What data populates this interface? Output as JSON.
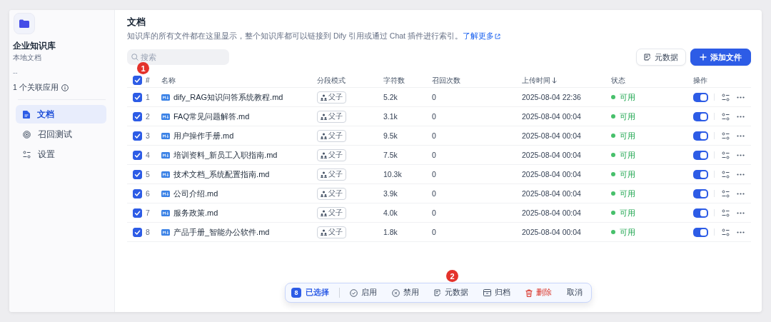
{
  "sidebar": {
    "title": "企业知识库",
    "subtitle": "本地文档",
    "description": "--",
    "linked_apps": "1 个关联应用",
    "nav": [
      {
        "label": "文档",
        "kind": "doc",
        "selected": true
      },
      {
        "label": "召回测试",
        "kind": "target",
        "selected": false
      },
      {
        "label": "设置",
        "kind": "settings",
        "selected": false
      }
    ]
  },
  "header": {
    "title": "文档",
    "description": "知识库的所有文件都在这里显示，整个知识库都可以链接到 Dify 引用或通过 Chat 插件进行索引。",
    "link": "了解更多"
  },
  "search": {
    "placeholder": "搜索"
  },
  "buttons": [
    {
      "label": "元数据",
      "kind": "secondary"
    },
    {
      "label": "添加文件",
      "kind": "primary"
    }
  ],
  "table": {
    "select_all": {
      "checked": true,
      "annotation": "1"
    },
    "columns": [
      {
        "label": "#",
        "sorted": false
      },
      {
        "label": "名称",
        "sorted": false
      },
      {
        "label": "分段模式",
        "sorted": false
      },
      {
        "label": "字符数",
        "sorted": false
      },
      {
        "label": "召回次数",
        "sorted": false
      },
      {
        "label": "上传时间",
        "sorted": true
      },
      {
        "label": "状态",
        "sorted": false
      },
      {
        "label": "操作",
        "sorted": false
      }
    ],
    "rows": [
      {
        "checked": true,
        "index": "1",
        "name": "dify_RAG知识问答系统教程.md",
        "mode": "父子",
        "chars": "5.2k",
        "recalls": "0",
        "uploaded": "2025-08-04 22:36",
        "status": "可用",
        "enabled": true
      },
      {
        "checked": true,
        "index": "2",
        "name": "FAQ常见问题解答.md",
        "mode": "父子",
        "chars": "3.1k",
        "recalls": "0",
        "uploaded": "2025-08-04 00:04",
        "status": "可用",
        "enabled": true
      },
      {
        "checked": true,
        "index": "3",
        "name": "用户操作手册.md",
        "mode": "父子",
        "chars": "9.5k",
        "recalls": "0",
        "uploaded": "2025-08-04 00:04",
        "status": "可用",
        "enabled": true
      },
      {
        "checked": true,
        "index": "4",
        "name": "培训资料_新员工入职指南.md",
        "mode": "父子",
        "chars": "7.5k",
        "recalls": "0",
        "uploaded": "2025-08-04 00:04",
        "status": "可用",
        "enabled": true
      },
      {
        "checked": true,
        "index": "5",
        "name": "技术文档_系统配置指南.md",
        "mode": "父子",
        "chars": "10.3k",
        "recalls": "0",
        "uploaded": "2025-08-04 00:04",
        "status": "可用",
        "enabled": true
      },
      {
        "checked": true,
        "index": "6",
        "name": "公司介绍.md",
        "mode": "父子",
        "chars": "3.9k",
        "recalls": "0",
        "uploaded": "2025-08-04 00:04",
        "status": "可用",
        "enabled": true
      },
      {
        "checked": true,
        "index": "7",
        "name": "服务政策.md",
        "mode": "父子",
        "chars": "4.0k",
        "recalls": "0",
        "uploaded": "2025-08-04 00:04",
        "status": "可用",
        "enabled": true
      },
      {
        "checked": true,
        "index": "8",
        "name": "产品手册_智能办公软件.md",
        "mode": "父子",
        "chars": "1.8k",
        "recalls": "0",
        "uploaded": "2025-08-04 00:04",
        "status": "可用",
        "enabled": true
      }
    ]
  },
  "batch_bar": {
    "count": "8",
    "label": "已选择",
    "actions": [
      {
        "label": "启用",
        "kind": "enable"
      },
      {
        "label": "禁用",
        "kind": "disable"
      },
      {
        "label": "元数据",
        "kind": "metadata",
        "annotation": "2"
      },
      {
        "label": "归档",
        "kind": "archive"
      },
      {
        "label": "删除",
        "kind": "delete"
      },
      {
        "label": "取消",
        "kind": "cancel"
      }
    ]
  }
}
